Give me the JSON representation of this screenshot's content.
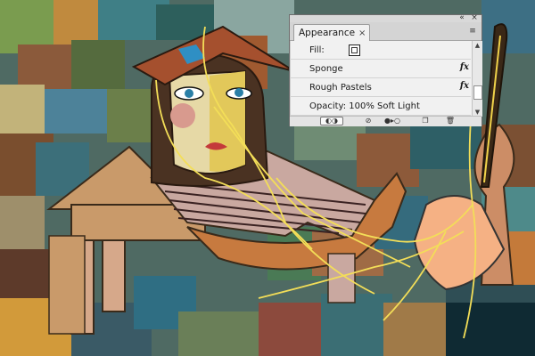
{
  "panel": {
    "tab_label": "Appearance",
    "tab_close": "×",
    "window_close": "×",
    "window_collapse": "«",
    "menu_glyph": "≡",
    "rows": [
      {
        "label": "Fill:",
        "kind": "fill"
      },
      {
        "label": "Sponge",
        "kind": "effect",
        "fx": "fx"
      },
      {
        "label": "Rough Pastels",
        "kind": "effect",
        "fx": "fx"
      },
      {
        "label": "Opacity: 100% Soft Light",
        "kind": "opacity"
      }
    ],
    "footer_buttons": [
      {
        "name": "new-art-maintains-appearance-button",
        "glyph": "◐◑"
      },
      {
        "name": "clear-appearance-button",
        "glyph": "⊘"
      },
      {
        "name": "reduce-to-basic-appearance-button",
        "glyph": "●▸○"
      },
      {
        "name": "duplicate-item-button",
        "glyph": "❐"
      },
      {
        "name": "delete-item-button",
        "glyph": "🗑"
      }
    ]
  },
  "colors": {
    "panel_bg": "#f1f1f1",
    "canvas_bg": "#5a6a5c"
  },
  "artwork": {
    "subject": "cubist-style painting of a woman with hat at easel"
  }
}
